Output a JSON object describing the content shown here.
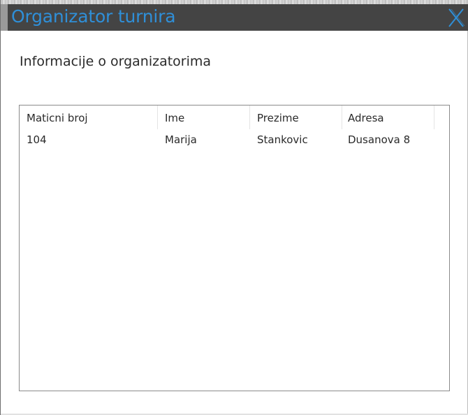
{
  "window": {
    "title": "Organizator turnira",
    "close_icon": "close-x-icon",
    "title_color": "#2f8fd8",
    "titlebar_color": "#444444"
  },
  "section": {
    "heading": "Informacije o organizatorima"
  },
  "table": {
    "columns": [
      "Maticni broj",
      "Ime",
      "Prezime",
      "Adresa"
    ],
    "rows": [
      [
        "104",
        "Marija",
        "Stankovic",
        "Dusanova 8"
      ]
    ]
  }
}
